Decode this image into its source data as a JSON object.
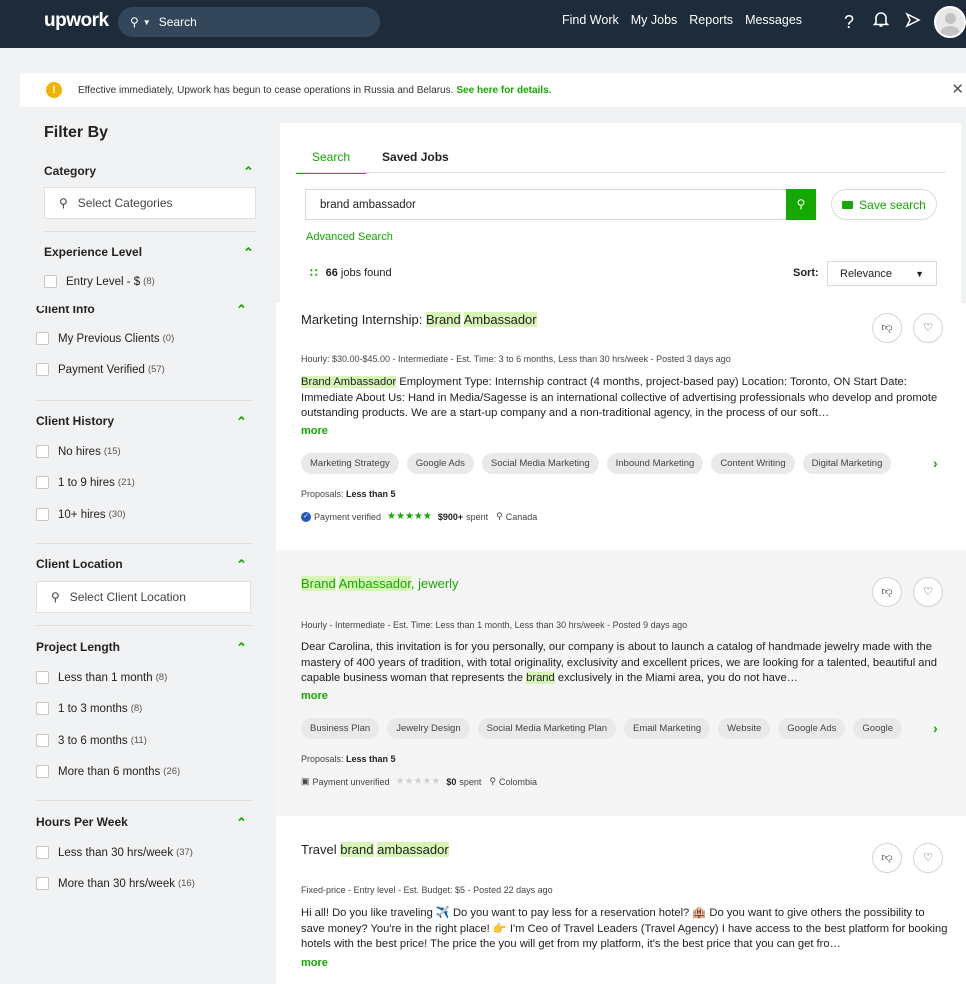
{
  "nav": {
    "logo": "upwork",
    "search_placeholder": "Search",
    "links": [
      "Find Work",
      "My Jobs",
      "Reports",
      "Messages"
    ]
  },
  "alert": {
    "text": "Effective immediately, Upwork has begun to cease operations in Russia and Belarus.",
    "link": "See here for details."
  },
  "sidebar": {
    "title": "Filter By",
    "category": {
      "title": "Category",
      "placeholder": "Select Categories"
    },
    "experience": {
      "title": "Experience Level",
      "items": [
        {
          "label": "Entry Level - $",
          "count": "(8)"
        }
      ]
    },
    "client_info": {
      "title": "Client Info",
      "items": [
        {
          "label": "My Previous Clients",
          "count": "(0)"
        },
        {
          "label": "Payment Verified",
          "count": "(57)"
        }
      ]
    },
    "client_history": {
      "title": "Client History",
      "items": [
        {
          "label": "No hires",
          "count": "(15)"
        },
        {
          "label": "1 to 9 hires",
          "count": "(21)"
        },
        {
          "label": "10+ hires",
          "count": "(30)"
        }
      ]
    },
    "client_location": {
      "title": "Client Location",
      "placeholder": "Select Client Location"
    },
    "project_length": {
      "title": "Project Length",
      "items": [
        {
          "label": "Less than 1 month",
          "count": "(8)"
        },
        {
          "label": "1 to 3 months",
          "count": "(8)"
        },
        {
          "label": "3 to 6 months",
          "count": "(11)"
        },
        {
          "label": "More than 6 months",
          "count": "(26)"
        }
      ]
    },
    "hours_per_week": {
      "title": "Hours Per Week",
      "items": [
        {
          "label": "Less than 30 hrs/week",
          "count": "(37)"
        },
        {
          "label": "More than 30 hrs/week",
          "count": "(16)"
        }
      ]
    }
  },
  "main": {
    "tabs": [
      "Search",
      "Saved Jobs"
    ],
    "search_value": "brand ambassador",
    "save_search": "Save search",
    "advanced": "Advanced Search",
    "jobs_count": "66",
    "jobs_found_label": "jobs found",
    "sort_label": "Sort:",
    "sort_value": "Relevance"
  },
  "jobs": [
    {
      "title_prefix": "Marketing Internship: ",
      "title_hl": [
        "Brand",
        "Ambassador"
      ],
      "meta": "Hourly: $30.00-$45.00 - Intermediate - Est. Time: 3 to 6 months, Less than 30 hrs/week - Posted 3 days ago",
      "desc_hl": "Brand Ambassador",
      "desc": " Employment Type: Internship contract (4 months, project-based pay) Location: Toronto, ON Start Date: Immediate About Us: Hand in Media/Sagesse is an international collective of advertising professionals who develop and promote outstanding products. We are a start-up company and a non-traditional agency, in the process of our soft…",
      "more": "more",
      "skills": [
        "Marketing Strategy",
        "Google Ads",
        "Social Media Marketing",
        "Inbound Marketing",
        "Content Writing",
        "Digital Marketing"
      ],
      "proposals_label": "Proposals:",
      "proposals": "Less than 5",
      "payment": "Payment verified",
      "spent_amount": "$900+",
      "spent_label": "spent",
      "country": "Canada"
    },
    {
      "title_hl": [
        "Brand",
        "Ambassador"
      ],
      "title_suffix": ", jewerly",
      "meta": "Hourly - Intermediate - Est. Time: Less than 1 month, Less than 30 hrs/week - Posted 9 days ago",
      "desc_a": "Dear Carolina, this invitation is for you personally, our company is about to launch a catalog of handmade jewelry made with the mastery of 400 years of tradition, with total originality, exclusivity and excellent prices, we are looking for a talented, beautiful and capable business woman that represents the ",
      "desc_hl": "brand",
      "desc_b": " exclusively in the Miami area, you do not have…",
      "more": "more",
      "skills": [
        "Business Plan",
        "Jewelry Design",
        "Social Media Marketing Plan",
        "Email Marketing",
        "Website",
        "Google Ads",
        "Google"
      ],
      "proposals_label": "Proposals:",
      "proposals": "Less than 5",
      "payment": "Payment unverified",
      "spent_amount": "$0",
      "spent_label": "spent",
      "country": "Colombia"
    },
    {
      "title_prefix": "Travel ",
      "title_hl": [
        "brand",
        "ambassador"
      ],
      "meta": "Fixed-price - Entry level - Est. Budget: $5 - Posted 22 days ago",
      "desc": "Hi all! Do you like traveling ✈️ Do you want to pay less for a reservation hotel? 🏨 Do you want to give others the possibility to save money? You're in the right place! 👉 I'm Ceo of Travel Leaders (Travel Agency) I have access to the best platform for booking hotels with the best price! The price the you will get from my platform, it's the best price that you can get fro…",
      "more": "more"
    }
  ]
}
